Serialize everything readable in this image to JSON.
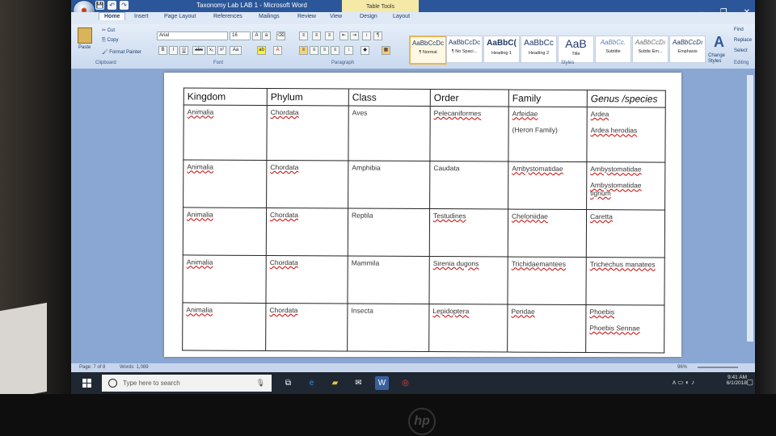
{
  "window": {
    "title": "Taxonomy Lab  LAB 1 - Microsoft Word",
    "contextual_tab_group": "Table Tools",
    "office_button": "Office",
    "qat": [
      "💾",
      "↶",
      "↷"
    ]
  },
  "tabs": [
    "Home",
    "Insert",
    "Page Layout",
    "References",
    "Mailings",
    "Review",
    "View",
    "Design",
    "Layout"
  ],
  "ribbon": {
    "clipboard": {
      "paste": "Paste",
      "cut": "Cut",
      "copy": "Copy",
      "format_painter": "Format Painter",
      "label": "Clipboard"
    },
    "font": {
      "font_name": "Arial",
      "font_size": "16",
      "label": "Font",
      "buttons": [
        "B",
        "I",
        "U",
        "abc",
        "x₂",
        "x²",
        "Aa"
      ]
    },
    "paragraph": {
      "label": "Paragraph"
    },
    "styles": {
      "label": "Styles",
      "items": [
        {
          "sample": "AaBbCcDc",
          "name": "¶ Normal"
        },
        {
          "sample": "AaBbCcDc",
          "name": "¶ No Spaci..."
        },
        {
          "sample": "AaBbC(",
          "name": "Heading 1"
        },
        {
          "sample": "AaBbCc",
          "name": "Heading 2"
        },
        {
          "sample": "AaB",
          "name": "Title"
        },
        {
          "sample": "AaBbCc.",
          "name": "Subtitle"
        },
        {
          "sample": "AaBbCcDı",
          "name": "Subtle Em..."
        },
        {
          "sample": "AaBbCcDı",
          "name": "Emphasis"
        }
      ],
      "change_styles": "Change Styles"
    },
    "editing": {
      "find": "Find",
      "replace": "Replace",
      "select": "Select",
      "label": "Editing"
    }
  },
  "table": {
    "headers": [
      "Kingdom",
      "Phylum",
      "Class",
      "Order",
      "Family",
      "Genus /species"
    ],
    "rows": [
      [
        [
          "Animalia"
        ],
        [
          "Chordata"
        ],
        [
          "Aves"
        ],
        [
          "Pelecaniformes"
        ],
        [
          "Arfeidae",
          "(Heron Family)"
        ],
        [
          "Ardea",
          "Ardea herodias"
        ]
      ],
      [
        [
          "Animalia"
        ],
        [
          "Chordata"
        ],
        [
          "Amphibia"
        ],
        [
          "Caudata"
        ],
        [
          "Ambystomatidae"
        ],
        [
          "Ambystomatidae",
          "Ambystomatidae tigrium"
        ]
      ],
      [
        [
          "Animalia"
        ],
        [
          "Chordata"
        ],
        [
          "Reptila"
        ],
        [
          "Testudines"
        ],
        [
          "Cheloniidae"
        ],
        [
          "Caretta"
        ]
      ],
      [
        [
          "Animalia"
        ],
        [
          "Chordata"
        ],
        [
          "Mammila"
        ],
        [
          "Sirenia dugons"
        ],
        [
          "Trichidaemantees"
        ],
        [
          "Trichechus manatees"
        ]
      ],
      [
        [
          "Animalia"
        ],
        [
          "Chordata"
        ],
        [
          "Insecta"
        ],
        [
          "Lepidoptera"
        ],
        [
          "Peridae"
        ],
        [
          "Phoebis",
          "Phoebis  Sennae"
        ]
      ]
    ]
  },
  "status": {
    "page": "Page: 7 of 8",
    "words": "Words: 1,089",
    "zoom": "96%"
  },
  "taskbar": {
    "search_placeholder": "Type here to search",
    "time": "9:41 AM",
    "date": "6/1/2018"
  },
  "brand": "hp"
}
